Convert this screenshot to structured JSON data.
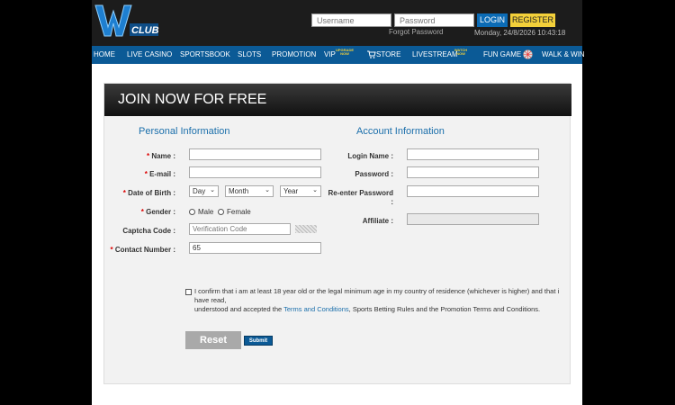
{
  "header": {
    "logo_text": "CLUB",
    "username_placeholder": "Username",
    "password_placeholder": "Password",
    "login_label": "LOGIN",
    "register_label": "REGISTER",
    "forgot_label": "Forgot Password",
    "datetime": "Monday, 24/8/2026 10:43:18"
  },
  "nav": {
    "items": [
      {
        "label": "HOME"
      },
      {
        "label": "LIVE CASINO"
      },
      {
        "label": "SPORTSBOOK"
      },
      {
        "label": "SLOTS"
      },
      {
        "label": "PROMOTION"
      },
      {
        "label": "VIP",
        "tag": "UPGRADE NOW"
      },
      {
        "label": "STORE"
      },
      {
        "label": "LIVESTREAM",
        "tag": "WATCH NOW"
      },
      {
        "label": "FUN GAME"
      },
      {
        "label": "WALK & WIN"
      }
    ]
  },
  "form": {
    "banner": "JOIN NOW FOR FREE",
    "personal_title": "Personal Information",
    "account_title": "Account Information",
    "name_label": "Name :",
    "email_label": "E-mail :",
    "dob_label": "Date of Birth :",
    "day_value": "Day",
    "month_value": "Month",
    "year_value": "Year",
    "gender_label": "Gender :",
    "male_label": "Male",
    "female_label": "Female",
    "captcha_label": "Captcha Code :",
    "captcha_placeholder": "Verification Code",
    "contact_label": "Contact Number :",
    "contact_value": "65",
    "login_name_label": "Login Name :",
    "password_label": "Password :",
    "reenter_label_1": "Re-enter Password",
    "reenter_label_2": ":",
    "affiliate_label": "Affiliate :",
    "terms_text_1": "I confirm that i am at least 18 year old or the legal minimum age in my country of residence (whichever is higher) and that i have read,",
    "terms_text_2": "understood and accepted the ",
    "terms_link": "Terms and Conditions",
    "terms_text_3": ", Sports Betting Rules and the Promotion Terms and Conditions.",
    "reset_label": "Reset",
    "submit_label": "Submit"
  },
  "colors": {
    "nav_bg": "#0b5a96",
    "accent_blue": "#1b6fab",
    "register_yellow": "#f3d03a",
    "required_red": "#d00000"
  }
}
